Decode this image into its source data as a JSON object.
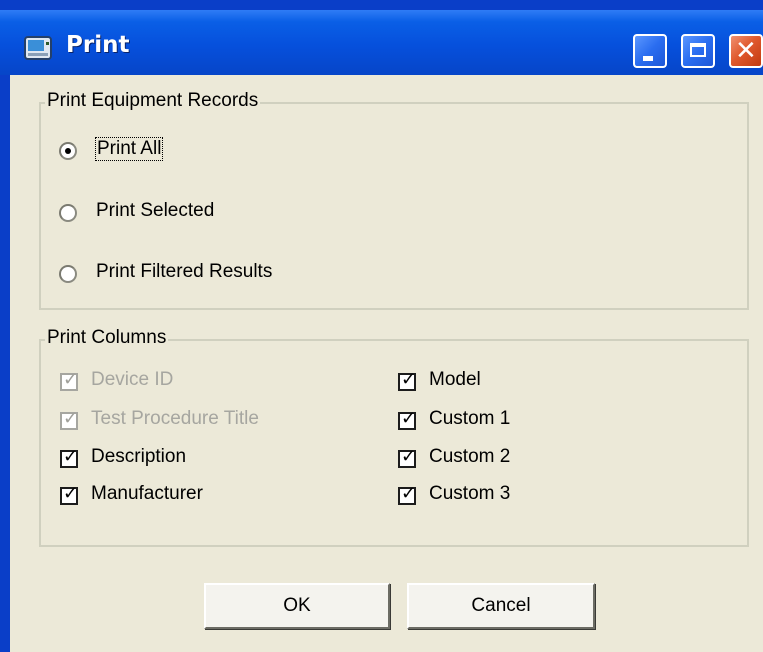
{
  "window": {
    "title": "Print"
  },
  "equipment_group": {
    "legend": "Print Equipment Records",
    "options": [
      {
        "label": "Print All",
        "checked": true
      },
      {
        "label": "Print Selected",
        "checked": false
      },
      {
        "label": "Print Filtered Results",
        "checked": false
      }
    ]
  },
  "columns_group": {
    "legend": "Print Columns",
    "left": [
      {
        "label": "Device ID",
        "checked": true,
        "enabled": false
      },
      {
        "label": "Test Procedure Title",
        "checked": true,
        "enabled": false
      },
      {
        "label": "Description",
        "checked": true,
        "enabled": true
      },
      {
        "label": "Manufacturer",
        "checked": true,
        "enabled": true
      }
    ],
    "right": [
      {
        "label": "Model",
        "checked": true,
        "enabled": true
      },
      {
        "label": "Custom 1",
        "checked": true,
        "enabled": true
      },
      {
        "label": "Custom 2",
        "checked": true,
        "enabled": true
      },
      {
        "label": "Custom 3",
        "checked": true,
        "enabled": true
      }
    ]
  },
  "buttons": {
    "ok": "OK",
    "cancel": "Cancel"
  }
}
